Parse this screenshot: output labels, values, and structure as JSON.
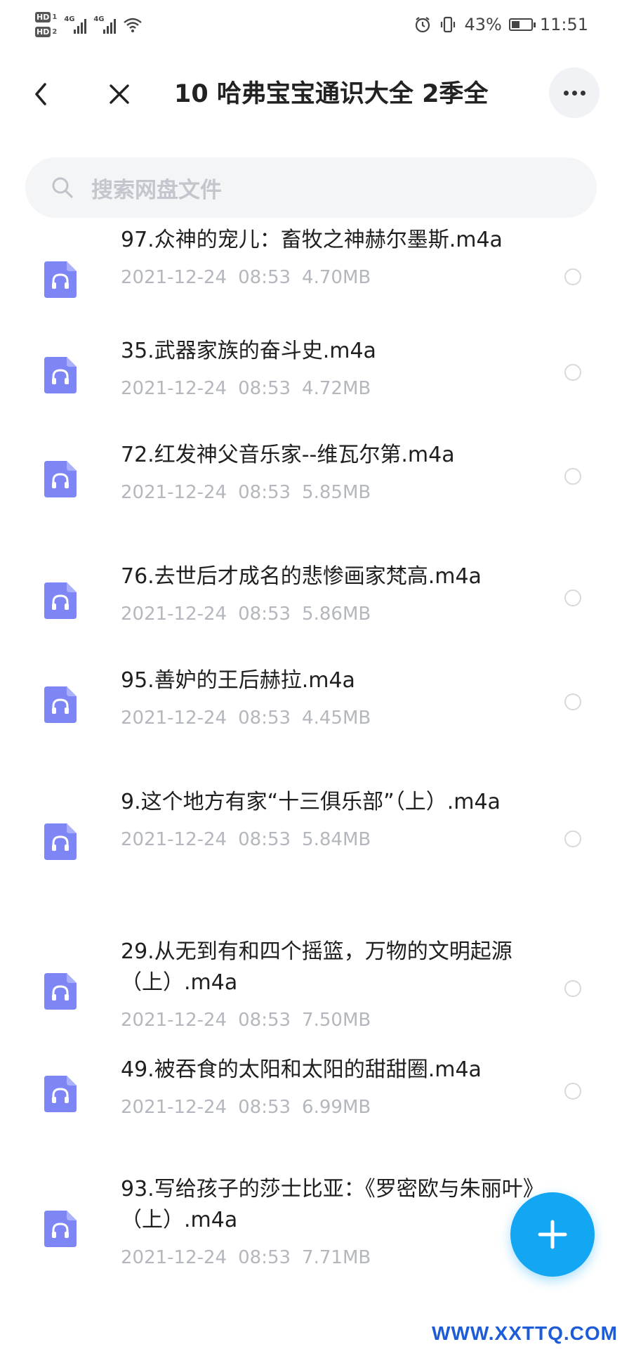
{
  "status_bar": {
    "hd_badges": [
      "HD",
      "HD"
    ],
    "hd_subs": [
      "1",
      "2"
    ],
    "network_labels": [
      "4G",
      "4G"
    ],
    "battery_percent_text": "43%",
    "battery_level": 0.43,
    "time": "11:51",
    "icons": [
      "alarm-icon",
      "vibrate-icon",
      "battery-charging-icon",
      "wifi-icon",
      "signal-icon"
    ]
  },
  "header": {
    "title": "10 哈弗宝宝通识大全 2季全"
  },
  "search": {
    "placeholder": "搜索网盘文件"
  },
  "files": [
    {
      "name": "97.众神的宠儿：畜牧之神赫尔墨斯.m4a",
      "date": "2021-12-24",
      "time": "08:53",
      "size": "4.70MB"
    },
    {
      "name": "35.武器家族的奋斗史.m4a",
      "date": "2021-12-24",
      "time": "08:53",
      "size": "4.72MB"
    },
    {
      "name": "72.红发神父音乐家--维瓦尔第.m4a",
      "date": "2021-12-24",
      "time": "08:53",
      "size": "5.85MB"
    },
    {
      "name": "76.去世后才成名的悲惨画家梵高.m4a",
      "date": "2021-12-24",
      "time": "08:53",
      "size": "5.86MB"
    },
    {
      "name": "95.善妒的王后赫拉.m4a",
      "date": "2021-12-24",
      "time": "08:53",
      "size": "4.45MB"
    },
    {
      "name": "9.这个地方有家“十三俱乐部”（上）.m4a",
      "date": "2021-12-24",
      "time": "08:53",
      "size": "5.84MB"
    },
    {
      "name": "29.从无到有和四个摇篮，万物的文明起源（上）.m4a",
      "date": "2021-12-24",
      "time": "08:53",
      "size": "7.50MB"
    },
    {
      "name": "49.被吞食的太阳和太阳的甜甜圈.m4a",
      "date": "2021-12-24",
      "time": "08:53",
      "size": "6.99MB"
    },
    {
      "name": "93.写给孩子的莎士比亚：《罗密欧与朱丽叶》（上）.m4a",
      "date": "2021-12-24",
      "time": "08:53",
      "size": "7.71MB"
    }
  ],
  "fab": {
    "icon": "plus-icon"
  },
  "watermark": "WWW.XXTTQ.COM",
  "colors": {
    "accent": "#12a6f3",
    "file_icon": "#7e86f5",
    "meta_text": "#b4b7bd",
    "watermark": "#1e5bd6"
  }
}
